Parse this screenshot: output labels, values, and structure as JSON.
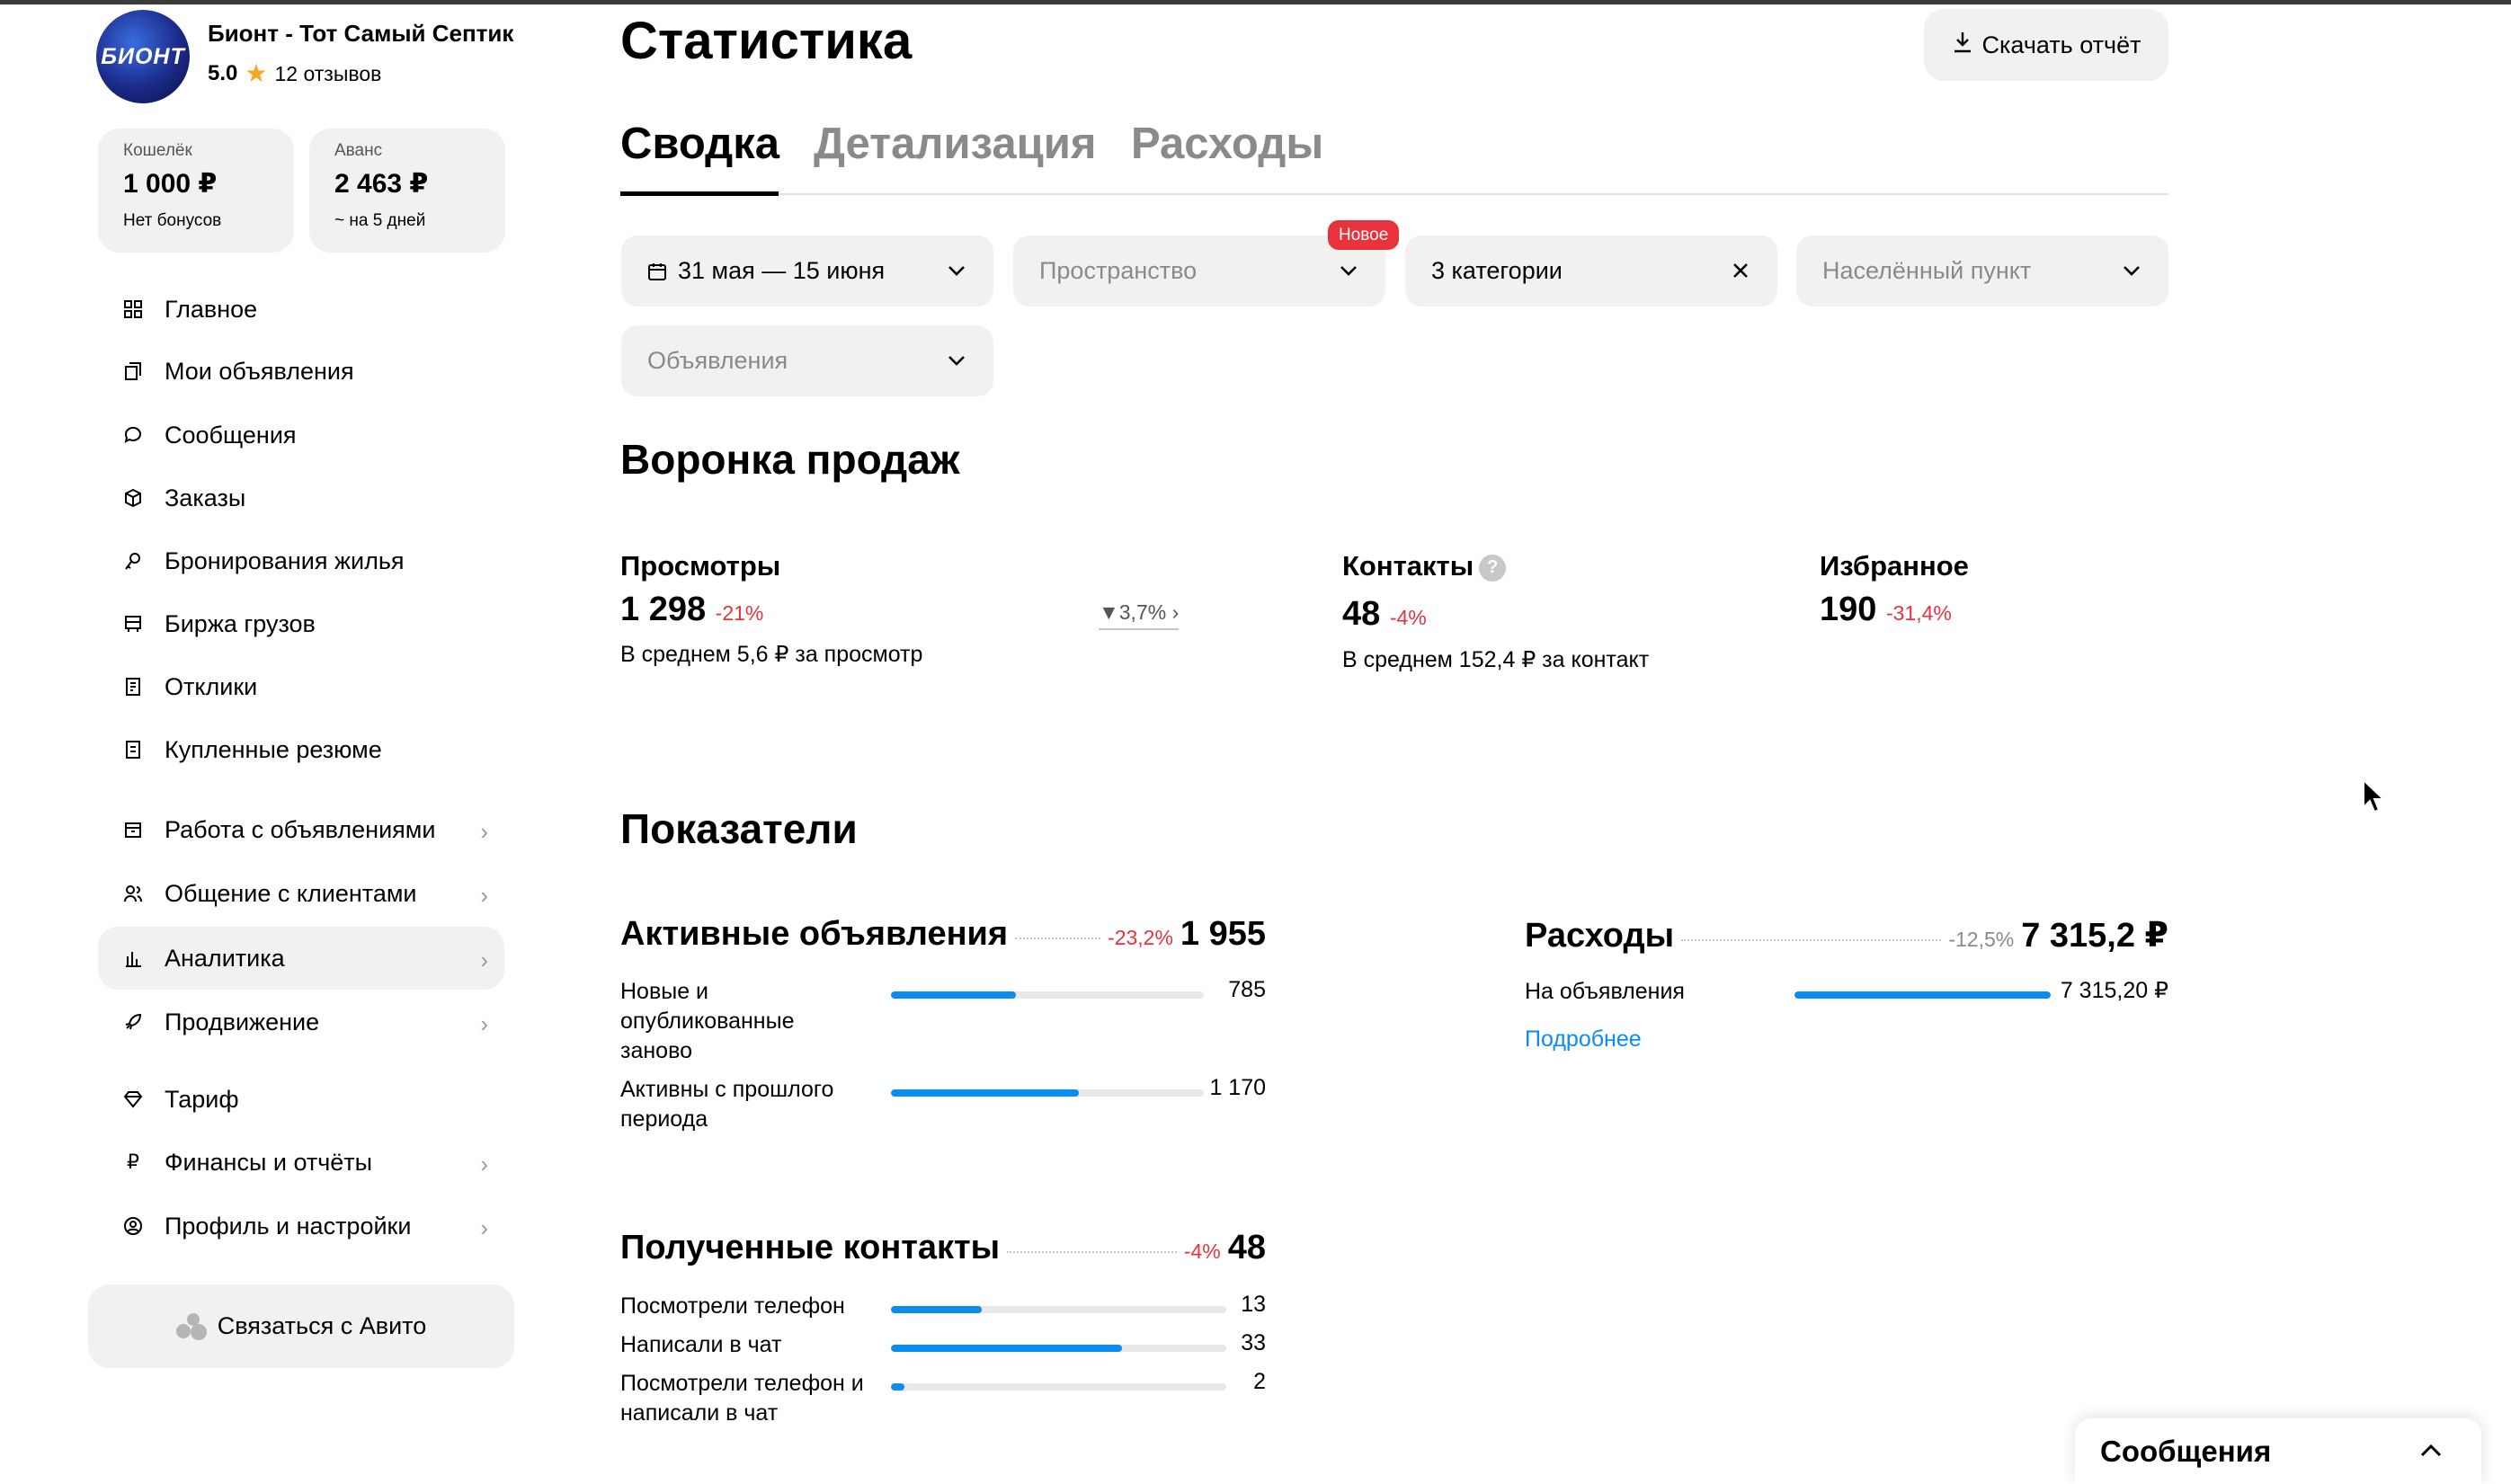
{
  "profile": {
    "logo_text": "БИОНТ",
    "name": "Бионт - Тот Самый Септик",
    "rating": "5.0",
    "reviews": "12 отзывов"
  },
  "wallet": {
    "label": "Кошелёк",
    "value": "1 000 ₽",
    "sub": "Нет бонусов"
  },
  "advance": {
    "label": "Аванс",
    "value": "2 463 ₽",
    "sub": "~ на 5 дней"
  },
  "nav": [
    {
      "label": "Главное",
      "icon": "grid-icon"
    },
    {
      "label": "Мои объявления",
      "icon": "listings-icon"
    },
    {
      "label": "Сообщения",
      "icon": "chat-icon"
    },
    {
      "label": "Заказы",
      "icon": "box-icon"
    },
    {
      "label": "Бронирования жилья",
      "icon": "booking-icon"
    },
    {
      "label": "Биржа грузов",
      "icon": "truck-icon"
    },
    {
      "label": "Отклики",
      "icon": "responses-icon"
    },
    {
      "label": "Купленные резюме",
      "icon": "resume-icon"
    },
    {
      "label": "Работа с объявлениями",
      "icon": "store-icon",
      "has_submenu": true
    },
    {
      "label": "Общение с клиентами",
      "icon": "users-icon",
      "has_submenu": true
    },
    {
      "label": "Аналитика",
      "icon": "analytics-icon",
      "has_submenu": true,
      "active": true
    },
    {
      "label": "Продвижение",
      "icon": "rocket-icon",
      "has_submenu": true
    },
    {
      "label": "Тариф",
      "icon": "diamond-icon"
    },
    {
      "label": "Финансы и отчёты",
      "icon": "ruble-icon",
      "has_submenu": true
    },
    {
      "label": "Профиль и настройки",
      "icon": "profile-icon",
      "has_submenu": true
    }
  ],
  "contact_avito": "Связаться с Авито",
  "header": {
    "title": "Статистика",
    "download": "Скачать отчёт"
  },
  "tabs": [
    "Сводка",
    "Детализация",
    "Расходы"
  ],
  "filters": {
    "date": "31 мая — 15 июня",
    "space": "Пространство",
    "new_badge": "Новое",
    "categories": "3 категории",
    "locality": "Населённый пункт",
    "ads": "Объявления"
  },
  "funnel": {
    "title": "Воронка продаж",
    "views": {
      "label": "Просмотры",
      "value": "1 298",
      "delta": "-21%",
      "sub": "В среднем 5,6 ₽ за просмотр",
      "conversion": "3,7%"
    },
    "contacts": {
      "label": "Контакты",
      "value": "48",
      "delta": "-4%",
      "sub": "В среднем 152,4 ₽ за контакт"
    },
    "favorites": {
      "label": "Избранное",
      "value": "190",
      "delta": "-31,4%"
    }
  },
  "indicators": {
    "title": "Показатели",
    "active_ads": {
      "title": "Активные объявления",
      "delta": "-23,2%",
      "value": "1 955",
      "rows": [
        {
          "label": "Новые и опубликованные заново",
          "value": "785",
          "fraction": 0.4
        },
        {
          "label": "Активны с прошлого периода",
          "value": "1 170",
          "fraction": 0.6
        }
      ]
    },
    "expenses": {
      "title": "Расходы",
      "delta": "-12,5%",
      "value": "7 315,2 ₽",
      "rows": [
        {
          "label": "На объявления",
          "value": "7 315,20 ₽",
          "fraction": 1.0
        }
      ],
      "more_link": "Подробнее"
    },
    "contacts_received": {
      "title": "Полученные контакты",
      "delta": "-4%",
      "value": "48",
      "rows": [
        {
          "label": "Посмотрели телефон",
          "value": "13",
          "fraction": 0.27
        },
        {
          "label": "Написали в чат",
          "value": "33",
          "fraction": 0.69
        },
        {
          "label": "Посмотрели телефон и написали в чат",
          "value": "2",
          "fraction": 0.04
        }
      ]
    }
  },
  "messages_panel": "Сообщения"
}
